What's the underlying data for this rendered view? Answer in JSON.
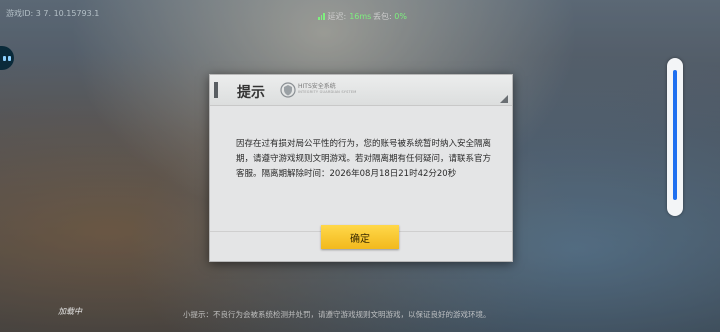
{
  "status": {
    "player_id": "游戏ID: 3 7. 10.15793.1",
    "ping_label": "延迟:",
    "ping_value": "16ms",
    "packet_label": "丢包:",
    "packet_value": "0%"
  },
  "dialog": {
    "title": "提示",
    "logo_text": "HITS安全系统",
    "logo_subtext": "INTEGRITY GUARDIAN SYSTEM",
    "message": "因存在过有损对局公平性的行为，您的账号被系统暂时纳入安全隔离期，请遵守游戏规则文明游戏。若对隔离期有任何疑问，请联系官方客服。隔离期解除时间：2026年08月18日21时42分20秒",
    "confirm_label": "确定"
  },
  "footer": {
    "loading": "加载中",
    "tip": "小提示：不良行为会被系统检测并处罚，请遵守游戏规则文明游戏，以保证良好的游戏环境。"
  },
  "colors": {
    "confirm_button": "#f6c42a",
    "ping_ok": "#7ef07e",
    "scroll_thumb": "#1e6ff0"
  }
}
